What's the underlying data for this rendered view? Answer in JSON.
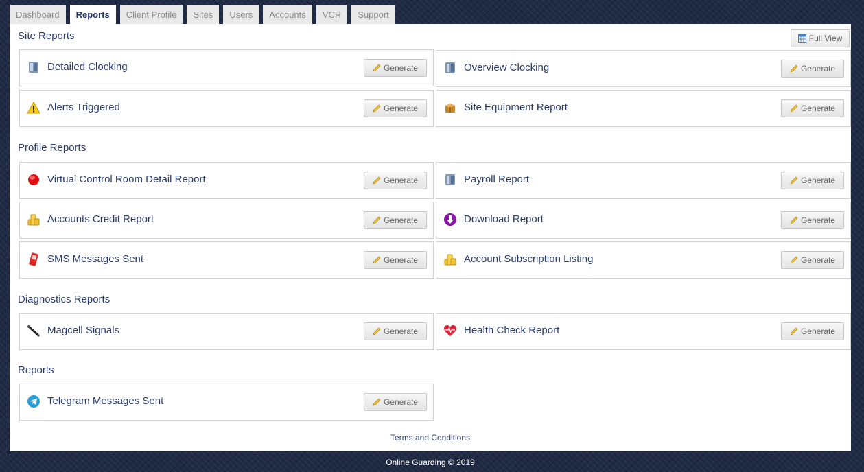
{
  "tabs": [
    {
      "label": "Dashboard",
      "active": false
    },
    {
      "label": "Reports",
      "active": true
    },
    {
      "label": "Client Profile",
      "active": false
    },
    {
      "label": "Sites",
      "active": false
    },
    {
      "label": "Users",
      "active": false
    },
    {
      "label": "Accounts",
      "active": false
    },
    {
      "label": "VCR",
      "active": false
    },
    {
      "label": "Support",
      "active": false
    }
  ],
  "full_view_label": "Full View",
  "generate_label": "Generate",
  "sections": {
    "site": {
      "title": "Site Reports",
      "items": [
        {
          "label": "Detailed Clocking",
          "icon": "server-icon"
        },
        {
          "label": "Overview Clocking",
          "icon": "server-icon"
        },
        {
          "label": "Alerts Triggered",
          "icon": "warning-icon"
        },
        {
          "label": "Site Equipment Report",
          "icon": "box-icon"
        }
      ]
    },
    "profile": {
      "title": "Profile Reports",
      "items": [
        {
          "label": "Virtual Control Room Detail Report",
          "icon": "record-icon"
        },
        {
          "label": "Payroll Report",
          "icon": "server-icon"
        },
        {
          "label": "Accounts Credit Report",
          "icon": "coins-icon"
        },
        {
          "label": "Download Report",
          "icon": "download-icon"
        },
        {
          "label": "SMS Messages Sent",
          "icon": "phone-icon"
        },
        {
          "label": "Account Subscription Listing",
          "icon": "coins-icon"
        }
      ]
    },
    "diagnostics": {
      "title": "Diagnostics Reports",
      "items": [
        {
          "label": "Magcell Signals",
          "icon": "antenna-icon"
        },
        {
          "label": "Health Check Report",
          "icon": "heart-pulse-icon"
        }
      ]
    },
    "reports": {
      "title": "Reports",
      "items": [
        {
          "label": "Telegram Messages Sent",
          "icon": "telegram-icon"
        }
      ]
    }
  },
  "terms_label": "Terms and Conditions",
  "footer_text": "Online Guarding © 2019"
}
